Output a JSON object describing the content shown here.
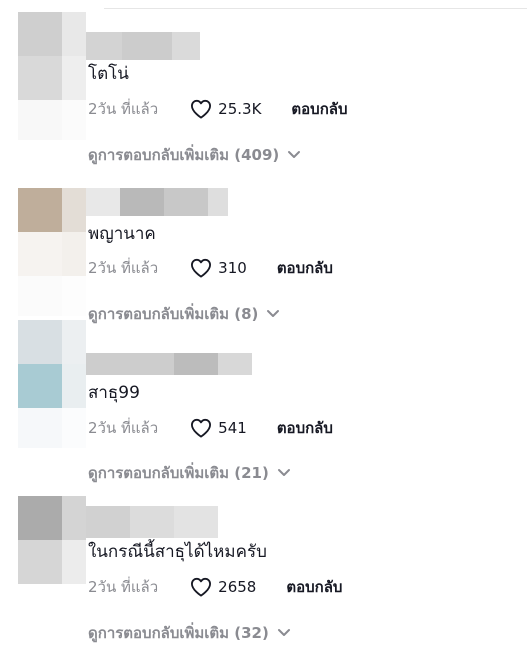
{
  "comments": [
    {
      "text": "โตโน่",
      "timestamp": "2วัน ที่แล้ว",
      "likes": "25.3K",
      "reply_label": "ตอบกลับ",
      "view_replies": "ดูการตอบกลับเพิ่มเติม (409)",
      "avatar_colors": [
        "#cfcfcf",
        "#e8e8e8",
        "#d9d9d9",
        "#eeeeee",
        "#f8f8f8",
        "#fbfbfb"
      ],
      "username_colors": [
        "#d3d3d3",
        "#cccccc",
        "#dadada"
      ]
    },
    {
      "text": "พญานาค",
      "timestamp": "2วัน ที่แล้ว",
      "likes": "310",
      "reply_label": "ตอบกลับ",
      "view_replies": "ดูการตอบกลับเพิ่มเติม (8)",
      "avatar_colors": [
        "#bfae9b",
        "#e3ddd6",
        "#f6f3f0",
        "#f3f0ec",
        "#fbfbfb",
        "#fdfdfd"
      ],
      "username_colors": [
        "#e8e8e8",
        "#b9b9b9",
        "#c8c8c8",
        "#dedede"
      ]
    },
    {
      "text": "สาธุ99",
      "timestamp": "2วัน ที่แล้ว",
      "likes": "541",
      "reply_label": "ตอบกลับ",
      "view_replies": "ดูการตอบกลับเพิ่มเติม (21)",
      "avatar_colors": [
        "#d8dfe3",
        "#eceff1",
        "#a8cbd3",
        "#e9eef0",
        "#f6f8fa",
        "#fbfcfd"
      ],
      "username_colors": [
        "#cdcdcd",
        "#bcbcbc",
        "#d8d8d8"
      ]
    },
    {
      "text": "ในกรณีนี้สาธุได้ไหมครับ",
      "timestamp": "2วัน ที่แล้ว",
      "likes": "2658",
      "reply_label": "ตอบกลับ",
      "view_replies": "ดูการตอบกลับเพิ่มเติม (32)",
      "avatar_colors": [
        "#ababab",
        "#d4d4d4",
        "#d6d6d6",
        "#ececec",
        "#fafafa",
        "#fdfdfd"
      ],
      "username_colors": [
        "#d1d1d1",
        "#dcdcdc",
        "#e3e3e3"
      ]
    }
  ],
  "colors": {
    "primary_text": "#161823",
    "secondary_text": "#8a8b91"
  },
  "icons": {
    "like": "heart-outline-icon",
    "expand": "chevron-down-icon"
  }
}
